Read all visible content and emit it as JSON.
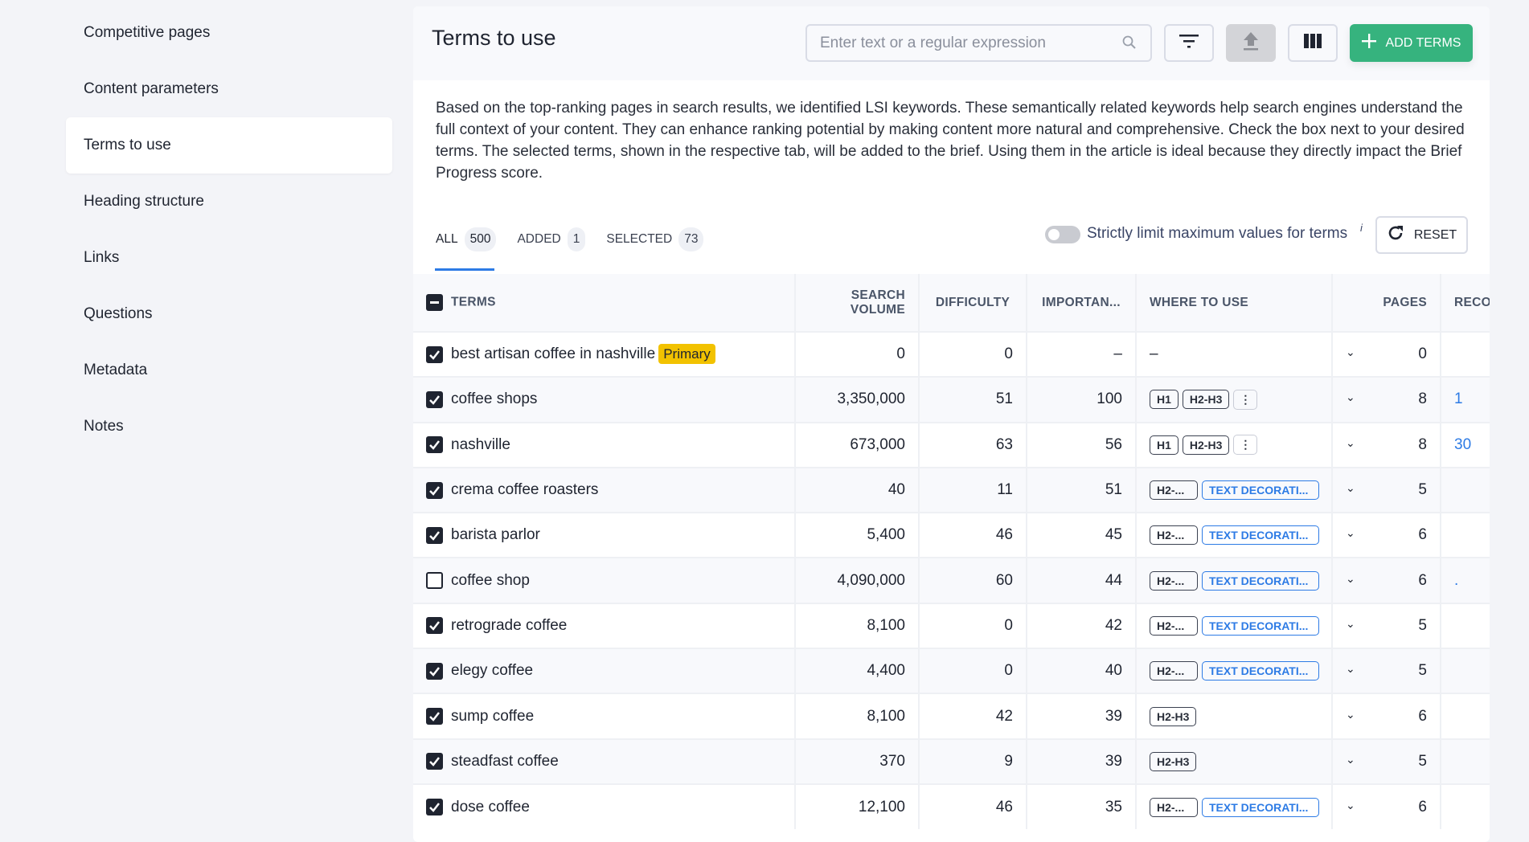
{
  "sidebar": {
    "items": [
      {
        "label": "Competitive pages",
        "active": false
      },
      {
        "label": "Content parameters",
        "active": false
      },
      {
        "label": "Terms to use",
        "active": true
      },
      {
        "label": "Heading structure",
        "active": false
      },
      {
        "label": "Links",
        "active": false
      },
      {
        "label": "Questions",
        "active": false
      },
      {
        "label": "Metadata",
        "active": false
      },
      {
        "label": "Notes",
        "active": false
      }
    ]
  },
  "header": {
    "title": "Terms to use",
    "search_placeholder": "Enter text or a regular expression",
    "add_terms_label": "ADD TERMS",
    "accent": "#36b37e"
  },
  "description": "Based on the top-ranking pages in search results, we identified LSI keywords. These semantically related keywords help search engines understand the full context of your content. They can enhance ranking potential by making content more natural and comprehensive. Check the box next to your desired terms. The selected terms, shown in the respective tab, will be added to the brief. Using them in the article is ideal because they directly impact the Brief Progress score.",
  "tabs": [
    {
      "label": "ALL",
      "count": "500",
      "active": true
    },
    {
      "label": "ADDED",
      "count": "1"
    },
    {
      "label": "SELECTED",
      "count": "73"
    }
  ],
  "toggle": {
    "label": "Strictly limit maximum values for terms",
    "info": "i",
    "on": false
  },
  "reset_label": "RESET",
  "table": {
    "columns": [
      "TERMS",
      "SEARCH VOLUME",
      "DIFFICULTY",
      "IMPORTAN...",
      "WHERE TO USE",
      "PAGES",
      "RECO"
    ],
    "primary_badge": "Primary",
    "rows": [
      {
        "term": "best artisan coffee in nashville",
        "primary": true,
        "checked": true,
        "volume": "0",
        "difficulty": "0",
        "importance": "–",
        "where": [],
        "where_text": "–",
        "pages": "0",
        "reco": ""
      },
      {
        "term": "coffee shops",
        "checked": true,
        "volume": "3,350,000",
        "difficulty": "51",
        "importance": "100",
        "where": [
          "H1",
          "H2-H3"
        ],
        "more": true,
        "pages": "8",
        "reco": "1"
      },
      {
        "term": "nashville",
        "checked": true,
        "volume": "673,000",
        "difficulty": "63",
        "importance": "56",
        "where": [
          "H1",
          "H2-H3"
        ],
        "more": true,
        "pages": "8",
        "reco": "30"
      },
      {
        "term": "crema coffee roasters",
        "checked": true,
        "volume": "40",
        "difficulty": "11",
        "importance": "51",
        "where": [
          "H2-...",
          "TEXT DECORATI..."
        ],
        "pages": "5",
        "reco": ""
      },
      {
        "term": "barista parlor",
        "checked": true,
        "volume": "5,400",
        "difficulty": "46",
        "importance": "45",
        "where": [
          "H2-...",
          "TEXT DECORATI..."
        ],
        "pages": "6",
        "reco": ""
      },
      {
        "term": "coffee shop",
        "checked": false,
        "volume": "4,090,000",
        "difficulty": "60",
        "importance": "44",
        "where": [
          "H2-...",
          "TEXT DECORATI..."
        ],
        "pages": "6",
        "reco": "."
      },
      {
        "term": "retrograde coffee",
        "checked": true,
        "volume": "8,100",
        "difficulty": "0",
        "importance": "42",
        "where": [
          "H2-...",
          "TEXT DECORATI..."
        ],
        "pages": "5",
        "reco": ""
      },
      {
        "term": "elegy coffee",
        "checked": true,
        "volume": "4,400",
        "difficulty": "0",
        "importance": "40",
        "where": [
          "H2-...",
          "TEXT DECORATI..."
        ],
        "pages": "5",
        "reco": ""
      },
      {
        "term": "sump coffee",
        "checked": true,
        "volume": "8,100",
        "difficulty": "42",
        "importance": "39",
        "where": [
          "H2-H3"
        ],
        "pages": "6",
        "reco": ""
      },
      {
        "term": "steadfast coffee",
        "checked": true,
        "volume": "370",
        "difficulty": "9",
        "importance": "39",
        "where": [
          "H2-H3"
        ],
        "pages": "5",
        "reco": ""
      },
      {
        "term": "dose coffee",
        "checked": true,
        "volume": "12,100",
        "difficulty": "46",
        "importance": "35",
        "where": [
          "H2-...",
          "TEXT DECORATI..."
        ],
        "pages": "6",
        "reco": ""
      }
    ]
  }
}
